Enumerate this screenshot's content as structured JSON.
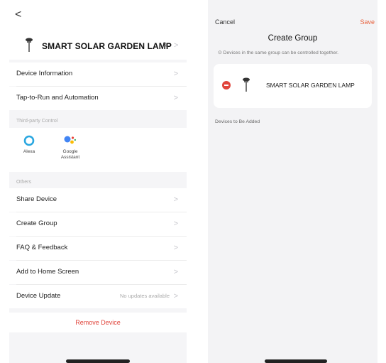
{
  "left": {
    "back_glyph": "<",
    "device_name": "SMART SOLAR GARDEN LAMP",
    "edit_glyph": "⌒",
    "chevron": ">",
    "rows_top": [
      {
        "label": "Device Information"
      },
      {
        "label": "Tap-to-Run and Automation"
      }
    ],
    "third_party_title": "Third-party Control",
    "third_party": [
      {
        "name": "alexa",
        "label": "Alexa",
        "label2": ""
      },
      {
        "name": "google-assistant",
        "label": "Google",
        "label2": "Assistant"
      }
    ],
    "others_title": "Others",
    "rows_others": [
      {
        "label": "Share Device",
        "extra": ""
      },
      {
        "label": "Create Group",
        "extra": ""
      },
      {
        "label": "FAQ & Feedback",
        "extra": ""
      },
      {
        "label": "Add to Home Screen",
        "extra": ""
      },
      {
        "label": "Device Update",
        "extra": "No updates available"
      }
    ],
    "remove_label": "Remove Device"
  },
  "right": {
    "cancel_label": "Cancel",
    "save_label": "Save",
    "title": "Create Group",
    "hint": "Devices in the same group can be controlled together.",
    "hint_icon": "⊙",
    "group_device": "SMART SOLAR GARDEN LAMP",
    "devices_to_add_label": "Devices to Be Added"
  },
  "colors": {
    "accent_orange": "#e8603c",
    "danger_red": "#e0443b",
    "alexa_blue": "#2aa7e0",
    "google_blue": "#4285f4",
    "google_red": "#ea4335",
    "google_yellow": "#fbbc05",
    "google_green": "#34a853"
  }
}
